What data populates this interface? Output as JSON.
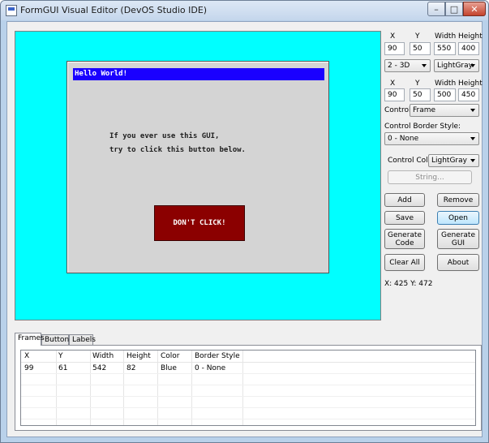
{
  "window": {
    "title": "FormGUI Visual Editor (DevOS Studio IDE)",
    "min_glyph": "–",
    "max_glyph": "□",
    "close_glyph": "✕"
  },
  "canvas": {
    "background_color": "#00FFFF",
    "frame": {
      "title": "Hello World!",
      "text_line1": "If you ever use this GUI,",
      "text_line2": "try to click this button below.",
      "button_label": "DON'T CLICK!"
    }
  },
  "frame_props": {
    "headers": {
      "x": "X",
      "y": "Y",
      "width": "Width",
      "height": "Height"
    },
    "x": "90",
    "y": "50",
    "width": "550",
    "height": "400",
    "style": "2 - 3D",
    "color": "LightGray"
  },
  "control_props": {
    "headers": {
      "x": "X",
      "y": "Y",
      "width": "Width",
      "height": "Height"
    },
    "x": "90",
    "y": "50",
    "width": "500",
    "height": "450",
    "control_label": "Control:",
    "control_value": "Frame",
    "border_style_label": "Control Border Style:",
    "border_style_value": "0 - None",
    "color_label": "Control Color:",
    "color_value": "LightGray",
    "string_button": "String..."
  },
  "actions": {
    "add": "Add",
    "remove": "Remove",
    "save": "Save",
    "open": "Open",
    "generate_code": "Generate\nCode",
    "generate_gui": "Generate\nGUI",
    "clear_all": "Clear All",
    "about": "About"
  },
  "status": {
    "coords": "X: 425  Y: 472"
  },
  "tabs": [
    {
      "label": "Frames",
      "active": true
    },
    {
      "label": "Buttons",
      "active": false
    },
    {
      "label": "Labels",
      "active": false
    }
  ],
  "table": {
    "columns": [
      "X",
      "Y",
      "Width",
      "Height",
      "Color",
      "Border Style"
    ],
    "rows": [
      [
        "99",
        "61",
        "542",
        "82",
        "Blue",
        "0 - None"
      ]
    ]
  }
}
